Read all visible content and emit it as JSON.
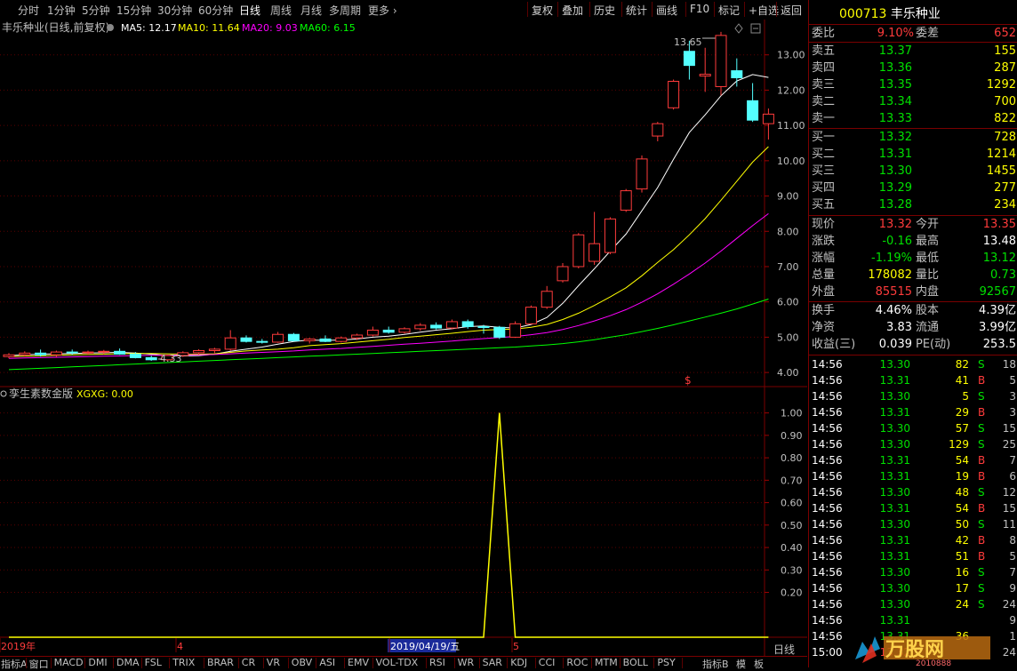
{
  "toolbar": {
    "periods": [
      "分时",
      "1分钟",
      "5分钟",
      "15分钟",
      "30分钟",
      "60分钟",
      "日线",
      "周线",
      "月线",
      "多周期",
      "更多"
    ],
    "active_period": "日线",
    "right_buttons": [
      "复权",
      "叠加",
      "历史",
      "统计",
      "画线",
      "F10",
      "标记",
      "+自选",
      "返回"
    ]
  },
  "main_panel": {
    "title": "丰乐种业(日线,前复权)",
    "ma_labels": [
      {
        "text": "MA5: 12.17",
        "color": "#ffffff"
      },
      {
        "text": "MA10: 11.64",
        "color": "#ffff00"
      },
      {
        "text": "MA20: 9.03",
        "color": "#ff00ff"
      },
      {
        "text": "MA60: 6.15",
        "color": "#00ff00"
      }
    ],
    "high_marker": "13.65",
    "low_marker": "4.33",
    "signal_marker": "$"
  },
  "sub_panel": {
    "title": "孪生素数金版",
    "indicator_label": "XGXG: 0.00"
  },
  "x_axis": {
    "labels": [
      "2019年",
      "4",
      "2019/04/19/五",
      "5"
    ],
    "period_button": "日线"
  },
  "chart_data": [
    {
      "type": "candlestick",
      "title": "丰乐种业(日线,前复权)",
      "y_ticks": [
        4.0,
        5.0,
        6.0,
        7.0,
        8.0,
        9.0,
        10.0,
        11.0,
        12.0,
        13.0
      ],
      "ylim": [
        3.6,
        14.0
      ],
      "candles": [
        {
          "o": 4.45,
          "h": 4.55,
          "l": 4.4,
          "c": 4.5
        },
        {
          "o": 4.5,
          "h": 4.6,
          "l": 4.45,
          "c": 4.55
        },
        {
          "o": 4.55,
          "h": 4.65,
          "l": 4.45,
          "c": 4.5
        },
        {
          "o": 4.5,
          "h": 4.62,
          "l": 4.44,
          "c": 4.58
        },
        {
          "o": 4.58,
          "h": 4.65,
          "l": 4.5,
          "c": 4.56
        },
        {
          "o": 4.56,
          "h": 4.62,
          "l": 4.5,
          "c": 4.58
        },
        {
          "o": 4.58,
          "h": 4.64,
          "l": 4.52,
          "c": 4.6
        },
        {
          "o": 4.6,
          "h": 4.68,
          "l": 4.5,
          "c": 4.52
        },
        {
          "o": 4.52,
          "h": 4.58,
          "l": 4.4,
          "c": 4.42
        },
        {
          "o": 4.42,
          "h": 4.48,
          "l": 4.33,
          "c": 4.36
        },
        {
          "o": 4.36,
          "h": 4.5,
          "l": 4.33,
          "c": 4.48
        },
        {
          "o": 4.48,
          "h": 4.6,
          "l": 4.44,
          "c": 4.56
        },
        {
          "o": 4.56,
          "h": 4.66,
          "l": 4.5,
          "c": 4.62
        },
        {
          "o": 4.62,
          "h": 4.7,
          "l": 4.55,
          "c": 4.66
        },
        {
          "o": 4.66,
          "h": 5.2,
          "l": 4.62,
          "c": 4.98
        },
        {
          "o": 4.98,
          "h": 5.05,
          "l": 4.85,
          "c": 4.88
        },
        {
          "o": 4.88,
          "h": 4.95,
          "l": 4.82,
          "c": 4.86
        },
        {
          "o": 4.86,
          "h": 5.15,
          "l": 4.84,
          "c": 5.08
        },
        {
          "o": 5.08,
          "h": 5.12,
          "l": 4.88,
          "c": 4.9
        },
        {
          "o": 4.9,
          "h": 4.98,
          "l": 4.82,
          "c": 4.95
        },
        {
          "o": 4.95,
          "h": 5.05,
          "l": 4.86,
          "c": 4.88
        },
        {
          "o": 4.88,
          "h": 5.02,
          "l": 4.85,
          "c": 4.98
        },
        {
          "o": 4.98,
          "h": 5.1,
          "l": 4.92,
          "c": 5.06
        },
        {
          "o": 5.06,
          "h": 5.3,
          "l": 5.02,
          "c": 5.2
        },
        {
          "o": 5.2,
          "h": 5.3,
          "l": 5.1,
          "c": 5.14
        },
        {
          "o": 5.14,
          "h": 5.28,
          "l": 5.1,
          "c": 5.24
        },
        {
          "o": 5.24,
          "h": 5.4,
          "l": 5.18,
          "c": 5.34
        },
        {
          "o": 5.34,
          "h": 5.42,
          "l": 5.22,
          "c": 5.26
        },
        {
          "o": 5.26,
          "h": 5.5,
          "l": 5.22,
          "c": 5.44
        },
        {
          "o": 5.44,
          "h": 5.5,
          "l": 5.24,
          "c": 5.3
        },
        {
          "o": 5.3,
          "h": 5.35,
          "l": 5.1,
          "c": 5.28
        },
        {
          "o": 5.28,
          "h": 5.32,
          "l": 4.95,
          "c": 5.0
        },
        {
          "o": 5.0,
          "h": 5.45,
          "l": 4.98,
          "c": 5.38
        },
        {
          "o": 5.38,
          "h": 5.9,
          "l": 5.36,
          "c": 5.85
        },
        {
          "o": 5.85,
          "h": 6.45,
          "l": 5.8,
          "c": 6.3
        },
        {
          "o": 6.6,
          "h": 7.1,
          "l": 6.55,
          "c": 7.0
        },
        {
          "o": 7.0,
          "h": 7.95,
          "l": 6.95,
          "c": 7.9
        },
        {
          "o": 7.15,
          "h": 8.55,
          "l": 7.05,
          "c": 7.65
        },
        {
          "o": 7.4,
          "h": 8.4,
          "l": 7.35,
          "c": 8.35
        },
        {
          "o": 8.6,
          "h": 9.2,
          "l": 8.55,
          "c": 9.15
        },
        {
          "o": 9.2,
          "h": 10.15,
          "l": 9.1,
          "c": 10.05
        },
        {
          "o": 10.7,
          "h": 11.1,
          "l": 10.55,
          "c": 11.05
        },
        {
          "o": 11.5,
          "h": 12.3,
          "l": 11.45,
          "c": 12.25
        },
        {
          "o": 13.1,
          "h": 13.4,
          "l": 12.3,
          "c": 12.7
        },
        {
          "o": 12.4,
          "h": 13.2,
          "l": 11.95,
          "c": 12.45
        },
        {
          "o": 12.1,
          "h": 13.65,
          "l": 11.85,
          "c": 13.55
        },
        {
          "o": 12.55,
          "h": 12.9,
          "l": 12.1,
          "c": 12.35
        },
        {
          "o": 11.7,
          "h": 12.2,
          "l": 11.1,
          "c": 11.15
        },
        {
          "o": 11.05,
          "h": 11.48,
          "l": 10.6,
          "c": 11.32
        }
      ],
      "ma_series": [
        {
          "name": "MA5",
          "color": "#ffffff",
          "values": [
            4.48,
            4.5,
            4.52,
            4.53,
            4.54,
            4.55,
            4.56,
            4.57,
            4.55,
            4.52,
            4.48,
            4.47,
            4.48,
            4.52,
            4.6,
            4.66,
            4.72,
            4.8,
            4.88,
            4.92,
            4.91,
            4.92,
            4.95,
            5.0,
            5.03,
            5.08,
            5.14,
            5.2,
            5.24,
            5.3,
            5.32,
            5.28,
            5.26,
            5.36,
            5.56,
            5.96,
            6.46,
            6.94,
            7.44,
            7.92,
            8.58,
            9.24,
            10.04,
            10.8,
            11.3,
            11.84,
            12.26,
            12.44,
            12.36
          ]
        },
        {
          "name": "MA10",
          "color": "#ffff00",
          "values": [
            4.45,
            4.46,
            4.47,
            4.49,
            4.5,
            4.51,
            4.52,
            4.53,
            4.54,
            4.54,
            4.53,
            4.52,
            4.52,
            4.53,
            4.57,
            4.61,
            4.64,
            4.66,
            4.7,
            4.76,
            4.79,
            4.82,
            4.86,
            4.9,
            4.94,
            4.99,
            5.03,
            5.07,
            5.11,
            5.16,
            5.2,
            5.22,
            5.23,
            5.28,
            5.36,
            5.5,
            5.68,
            5.9,
            6.14,
            6.4,
            6.74,
            7.12,
            7.48,
            7.9,
            8.36,
            8.88,
            9.42,
            9.96,
            10.4
          ]
        },
        {
          "name": "MA20",
          "color": "#ff00ff",
          "values": [
            4.4,
            4.41,
            4.42,
            4.43,
            4.44,
            4.45,
            4.46,
            4.47,
            4.48,
            4.49,
            4.49,
            4.5,
            4.5,
            4.51,
            4.53,
            4.55,
            4.57,
            4.59,
            4.61,
            4.64,
            4.66,
            4.68,
            4.71,
            4.74,
            4.77,
            4.8,
            4.83,
            4.86,
            4.89,
            4.93,
            4.96,
            4.99,
            5.02,
            5.07,
            5.13,
            5.22,
            5.33,
            5.46,
            5.61,
            5.78,
            5.99,
            6.23,
            6.5,
            6.79,
            7.1,
            7.44,
            7.8,
            8.16,
            8.5
          ]
        },
        {
          "name": "MA60",
          "color": "#00ff00",
          "values": [
            4.08,
            4.1,
            4.12,
            4.14,
            4.16,
            4.18,
            4.2,
            4.22,
            4.24,
            4.26,
            4.28,
            4.3,
            4.32,
            4.34,
            4.36,
            4.38,
            4.4,
            4.42,
            4.44,
            4.46,
            4.48,
            4.5,
            4.52,
            4.54,
            4.56,
            4.58,
            4.6,
            4.62,
            4.64,
            4.66,
            4.68,
            4.7,
            4.72,
            4.75,
            4.78,
            4.82,
            4.87,
            4.93,
            5.0,
            5.07,
            5.16,
            5.25,
            5.35,
            5.46,
            5.57,
            5.68,
            5.8,
            5.94,
            6.08
          ]
        }
      ]
    },
    {
      "type": "line",
      "title": "孪生素数金版",
      "series": [
        {
          "name": "XGXG",
          "color": "#ffff00",
          "values": [
            0,
            0,
            0,
            0,
            0,
            0,
            0,
            0,
            0,
            0,
            0,
            0,
            0,
            0,
            0,
            0,
            0,
            0,
            0,
            0,
            0,
            0,
            0,
            0,
            0,
            0,
            0,
            0,
            0,
            0,
            0,
            1,
            0,
            0,
            0,
            0,
            0,
            0,
            0,
            0,
            0,
            0,
            0,
            0,
            0,
            0,
            0,
            0,
            0
          ]
        }
      ],
      "y_ticks": [
        0.2,
        0.3,
        0.4,
        0.5,
        0.6,
        0.7,
        0.8,
        0.9,
        1.0
      ],
      "ylim": [
        0,
        1.05
      ]
    }
  ],
  "quote": {
    "code": "000713",
    "name": "丰乐种业",
    "weibi_label": "委比",
    "weibi_value": "9.10%",
    "weicha_label": "委差",
    "weicha_value": "652",
    "sells": [
      {
        "label": "卖五",
        "price": "13.37",
        "vol": "155"
      },
      {
        "label": "卖四",
        "price": "13.36",
        "vol": "287"
      },
      {
        "label": "卖三",
        "price": "13.35",
        "vol": "1292"
      },
      {
        "label": "卖二",
        "price": "13.34",
        "vol": "700"
      },
      {
        "label": "卖一",
        "price": "13.33",
        "vol": "822"
      }
    ],
    "buys": [
      {
        "label": "买一",
        "price": "13.32",
        "vol": "728"
      },
      {
        "label": "买二",
        "price": "13.31",
        "vol": "1214"
      },
      {
        "label": "买三",
        "price": "13.30",
        "vol": "1455"
      },
      {
        "label": "买四",
        "price": "13.29",
        "vol": "277"
      },
      {
        "label": "买五",
        "price": "13.28",
        "vol": "234"
      }
    ],
    "stats": [
      {
        "l1": "现价",
        "v1": "13.32",
        "c1": "#ff3b3b",
        "l2": "今开",
        "v2": "13.35",
        "c2": "#ff3b3b"
      },
      {
        "l1": "涨跌",
        "v1": "-0.16",
        "c1": "#00e000",
        "l2": "最高",
        "v2": "13.48",
        "c2": "#ffffff"
      },
      {
        "l1": "涨幅",
        "v1": "-1.19%",
        "c1": "#00e000",
        "l2": "最低",
        "v2": "13.12",
        "c2": "#00e000"
      },
      {
        "l1": "总量",
        "v1": "178082",
        "c1": "#ffff00",
        "l2": "量比",
        "v2": "0.73",
        "c2": "#00e000"
      },
      {
        "l1": "外盘",
        "v1": "85515",
        "c1": "#ff3b3b",
        "l2": "内盘",
        "v2": "92567",
        "c2": "#00e000"
      }
    ],
    "stats2": [
      {
        "l1": "换手",
        "v1": "4.46%",
        "l2": "股本",
        "v2": "4.39亿"
      },
      {
        "l1": "净资",
        "v1": "3.83",
        "l2": "流通",
        "v2": "3.99亿"
      },
      {
        "l1": "收益(三)",
        "v1": "0.039",
        "l2": "PE(动)",
        "v2": "253.5"
      }
    ],
    "ticks": [
      {
        "t": "14:56",
        "p": "13.30",
        "pc": "#00e000",
        "v": "82",
        "s": "S",
        "n": "18"
      },
      {
        "t": "14:56",
        "p": "13.31",
        "pc": "#00e000",
        "v": "41",
        "s": "B",
        "n": "5"
      },
      {
        "t": "14:56",
        "p": "13.30",
        "pc": "#00e000",
        "v": "5",
        "s": "S",
        "n": "3"
      },
      {
        "t": "14:56",
        "p": "13.31",
        "pc": "#00e000",
        "v": "29",
        "s": "B",
        "n": "3"
      },
      {
        "t": "14:56",
        "p": "13.30",
        "pc": "#00e000",
        "v": "57",
        "s": "S",
        "n": "15"
      },
      {
        "t": "14:56",
        "p": "13.30",
        "pc": "#00e000",
        "v": "129",
        "s": "S",
        "n": "25"
      },
      {
        "t": "14:56",
        "p": "13.31",
        "pc": "#00e000",
        "v": "54",
        "s": "B",
        "n": "7"
      },
      {
        "t": "14:56",
        "p": "13.31",
        "pc": "#00e000",
        "v": "19",
        "s": "B",
        "n": "6"
      },
      {
        "t": "14:56",
        "p": "13.30",
        "pc": "#00e000",
        "v": "48",
        "s": "S",
        "n": "12"
      },
      {
        "t": "14:56",
        "p": "13.31",
        "pc": "#00e000",
        "v": "54",
        "s": "B",
        "n": "15"
      },
      {
        "t": "14:56",
        "p": "13.30",
        "pc": "#00e000",
        "v": "50",
        "s": "S",
        "n": "11"
      },
      {
        "t": "14:56",
        "p": "13.31",
        "pc": "#00e000",
        "v": "42",
        "s": "B",
        "n": "8"
      },
      {
        "t": "14:56",
        "p": "13.31",
        "pc": "#00e000",
        "v": "51",
        "s": "B",
        "n": "5"
      },
      {
        "t": "14:56",
        "p": "13.30",
        "pc": "#00e000",
        "v": "16",
        "s": "S",
        "n": "7"
      },
      {
        "t": "14:56",
        "p": "13.30",
        "pc": "#00e000",
        "v": "17",
        "s": "S",
        "n": "9"
      },
      {
        "t": "14:56",
        "p": "13.30",
        "pc": "#00e000",
        "v": "24",
        "s": "S",
        "n": "24"
      },
      {
        "t": "14:56",
        "p": "13.31",
        "pc": "#00e000",
        "v": "",
        "s": "",
        "n": "9"
      },
      {
        "t": "14:56",
        "p": "13.31",
        "pc": "#00e000",
        "v": "36",
        "s": "",
        "n": "1"
      },
      {
        "t": "15:00",
        "p": "13.32",
        "pc": "#ff3b3b",
        "v": "",
        "s": "",
        "n": "24"
      }
    ]
  },
  "bottom_tabs": [
    "指标A",
    "窗口",
    "MACD",
    "DMI",
    "DMA",
    "FSL",
    "TRIX",
    "BRAR",
    "CR",
    "VR",
    "OBV",
    "ASI",
    "EMV",
    "VOL-TDX",
    "RSI",
    "WR",
    "SAR",
    "KDJ",
    "CCI",
    "ROC",
    "MTM",
    "BOLL",
    "PSY"
  ],
  "bottom_right": [
    "指标B",
    "模",
    "板"
  ],
  "watermark": {
    "brand": "万股网",
    "site": "2010888"
  }
}
